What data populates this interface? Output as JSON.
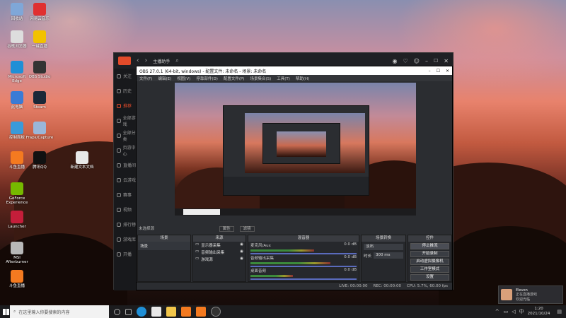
{
  "desktop": {
    "icons": [
      {
        "label": "回收站",
        "color": "#7fa7d8"
      },
      {
        "label": "网易云音乐",
        "color": "#e03030"
      },
      {
        "label": "谷歌浏览器",
        "color": "#ddd"
      },
      {
        "label": "一键直播",
        "color": "#f2c200"
      },
      {
        "label": "Microsoft Edge",
        "color": "#1f8fd6"
      },
      {
        "label": "OBS Studio",
        "color": "#333"
      },
      {
        "label": "此电脑",
        "color": "#3a7bd5"
      },
      {
        "label": "Steam",
        "color": "#1b2838"
      },
      {
        "label": "控制面板",
        "color": "#3a9ad9"
      },
      {
        "label": "Fraps/Capture",
        "color": "#9ab7d9"
      },
      {
        "label": "斗鱼直播",
        "color": "#f47a20"
      },
      {
        "label": "腾讯QQ",
        "color": "#111"
      },
      {
        "label": "新建文本文档",
        "color": "#e8e8e8"
      },
      {
        "label": "GeForce Experience",
        "color": "#76b900"
      },
      {
        "label": "Launcher",
        "color": "#c41e3a"
      },
      {
        "label": "MSI Afterburner",
        "color": "#b8b8b8"
      },
      {
        "label": "斗鱼直播",
        "color": "#f47a20"
      }
    ]
  },
  "app": {
    "title": "主播助手",
    "sidebar": [
      "关注",
      "历史",
      "推荐",
      "全部游戏",
      "全部分类",
      "页游中心",
      "直播间",
      "云游戏",
      "赛事",
      "视频",
      "排行榜",
      "游戏库",
      "开播"
    ],
    "active_index": 2
  },
  "obs": {
    "title": "OBS 27.0.1 (64-bit, windows) - 配置文件: 未命名 - 场景: 未命名",
    "menu": [
      "文件(F)",
      "编辑(E)",
      "视图(V)",
      "停靠部件(D)",
      "配置文件(P)",
      "场景集合(S)",
      "工具(T)",
      "帮助(H)"
    ],
    "source_label": "未选择源",
    "props_label": "属性",
    "filters_label": "滤镜",
    "panels": {
      "scenes": {
        "title": "场景",
        "items": [
          "场景"
        ]
      },
      "sources": {
        "title": "来源",
        "items": [
          "显示器采集",
          "音频输出采集",
          "游戏源"
        ]
      },
      "mixer": {
        "title": "混音器",
        "tracks": [
          {
            "name": "麦克风/Aux",
            "db": "0.0 dB",
            "level": 0.6
          },
          {
            "name": "音频输出采集",
            "db": "0.0 dB",
            "level": 0.75
          },
          {
            "name": "桌面音频",
            "db": "0.0 dB",
            "level": 0.4
          }
        ]
      },
      "transitions": {
        "title": "场景转换",
        "type": "淡出",
        "duration_label": "时长",
        "duration": "300 ms"
      },
      "controls": {
        "title": "控件",
        "buttons": [
          "停止推流",
          "开始录制",
          "启动虚拟摄像机",
          "工作室模式",
          "设置",
          "退出"
        ]
      }
    },
    "status": {
      "live_label": "LIVE:",
      "live_time": "00:00:00",
      "rec_label": "REC:",
      "rec_time": "00:00:00",
      "cpu": "CPU: 5.7%, 60.00 fps"
    }
  },
  "taskbar": {
    "search_placeholder": "在这里输入你要搜索的内容",
    "time": "1:20",
    "date": "2021/10/24"
  },
  "toast": {
    "name": "Eleven",
    "line1": "正在直播游戏",
    "line2": "欢迎光临"
  }
}
